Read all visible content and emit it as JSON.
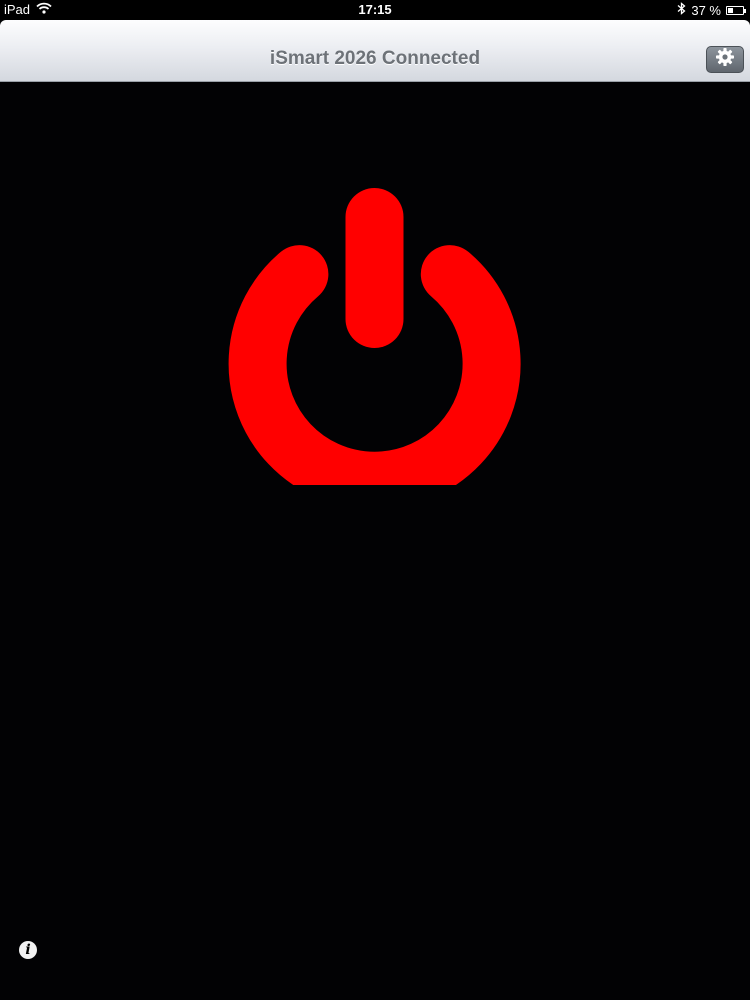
{
  "status_bar": {
    "device": "iPad",
    "time": "17:15",
    "battery_text": "37 %",
    "battery_level": 0.37,
    "icons": [
      "wifi-icon",
      "bluetooth-icon",
      "battery-icon"
    ]
  },
  "nav_bar": {
    "title": "iSmart 2026 Connected",
    "settings_icon": "gear-icon"
  },
  "main": {
    "power_icon": "power-icon",
    "power_color": "#ff0000",
    "background_color": "#020204"
  },
  "footer": {
    "info_glyph": "i",
    "info_icon": "info-icon"
  }
}
